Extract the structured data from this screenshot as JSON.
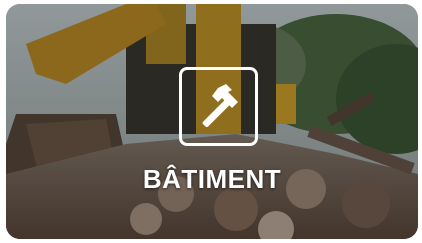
{
  "card": {
    "title": "BÂTIMENT",
    "icon": "hammer-icon"
  },
  "colors": {
    "text": "#ffffff",
    "icon_border": "#ffffff"
  }
}
